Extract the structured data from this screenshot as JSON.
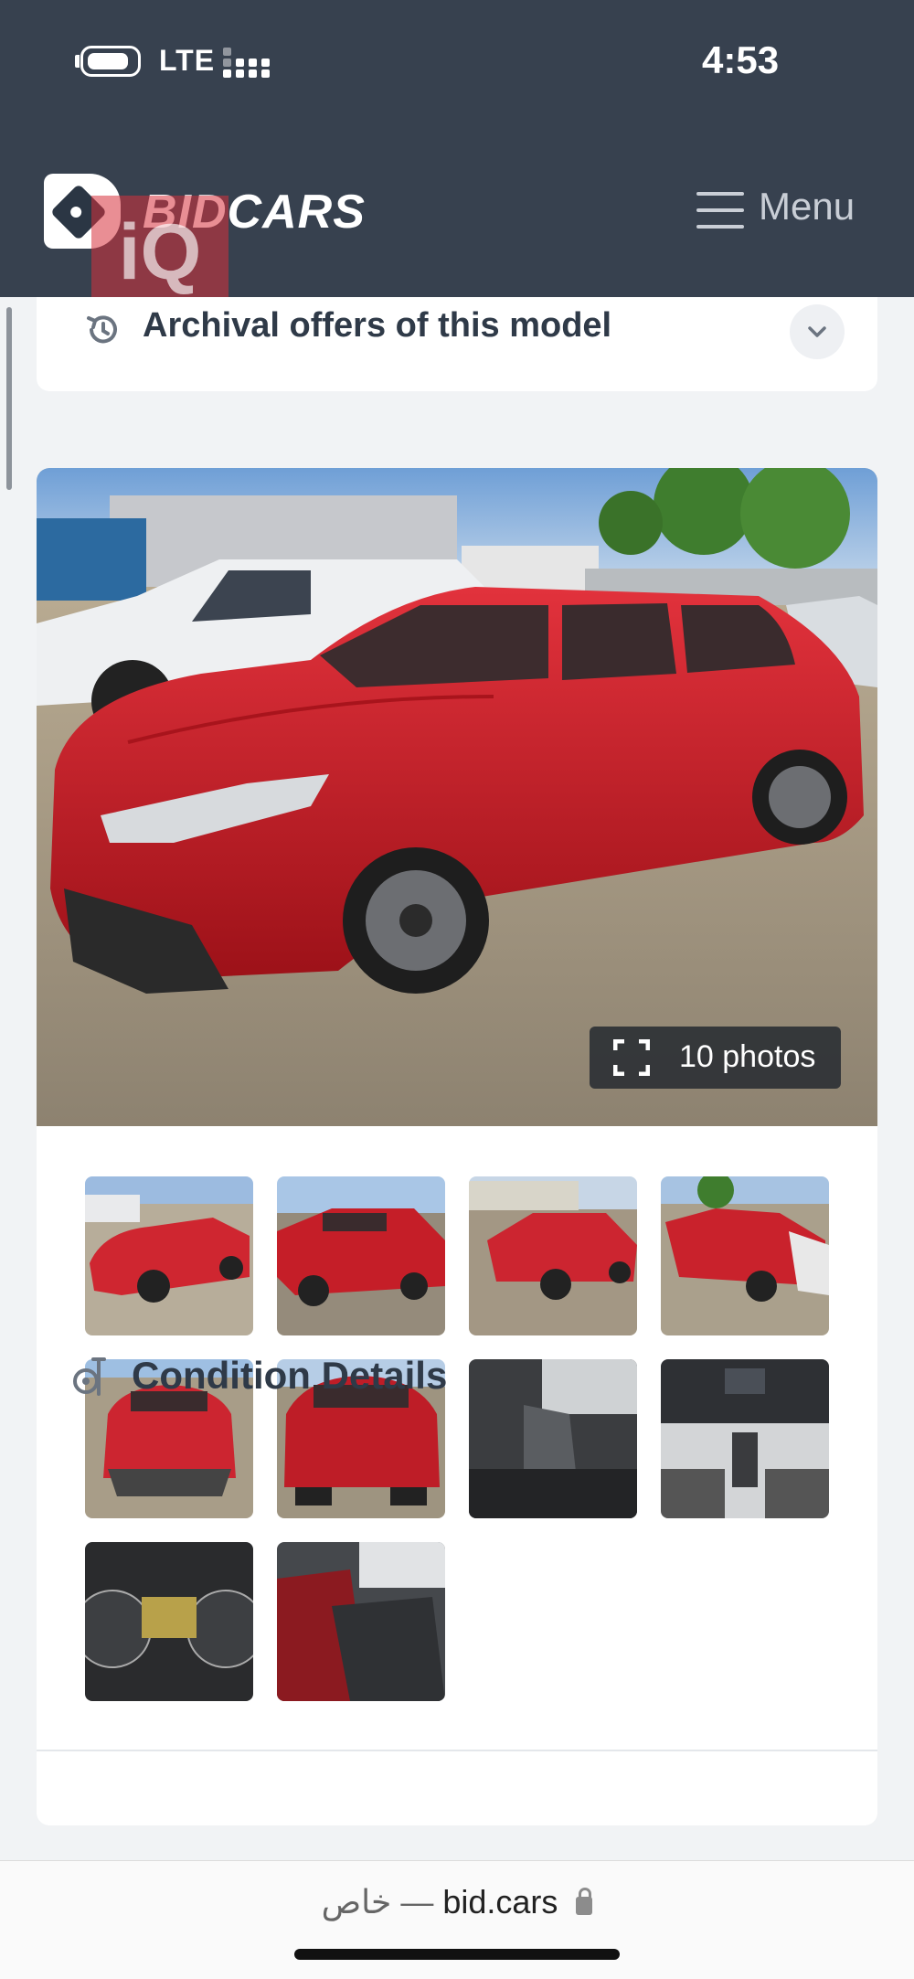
{
  "status_bar": {
    "network": "LTE",
    "time": "4:53"
  },
  "header": {
    "brand": "BIDCARS",
    "watermark": "iQ",
    "menu_label": "Menu"
  },
  "archive": {
    "title": "Archival offers of this model"
  },
  "gallery": {
    "photos_button_label": "10 photos",
    "thumbnails": [
      {
        "name": "thumb-front-left",
        "caption": ""
      },
      {
        "name": "thumb-rear-right",
        "caption": ""
      },
      {
        "name": "thumb-rear-side",
        "caption": ""
      },
      {
        "name": "thumb-damaged-front",
        "caption": ""
      },
      {
        "name": "thumb-front",
        "caption": ""
      },
      {
        "name": "thumb-rear",
        "caption": ""
      },
      {
        "name": "thumb-driver-seat",
        "caption": ""
      },
      {
        "name": "thumb-dashboard",
        "caption": ""
      },
      {
        "name": "thumb-gauges",
        "caption": ""
      },
      {
        "name": "thumb-rear-seats",
        "caption": ""
      }
    ]
  },
  "condition": {
    "title": "Condition Details"
  },
  "browser": {
    "private_label": "خاص",
    "separator": "—",
    "domain": "bid.cars"
  },
  "colors": {
    "header_bg": "#37414f",
    "car_red": "#c8202a",
    "page_bg": "#f1f3f5"
  }
}
